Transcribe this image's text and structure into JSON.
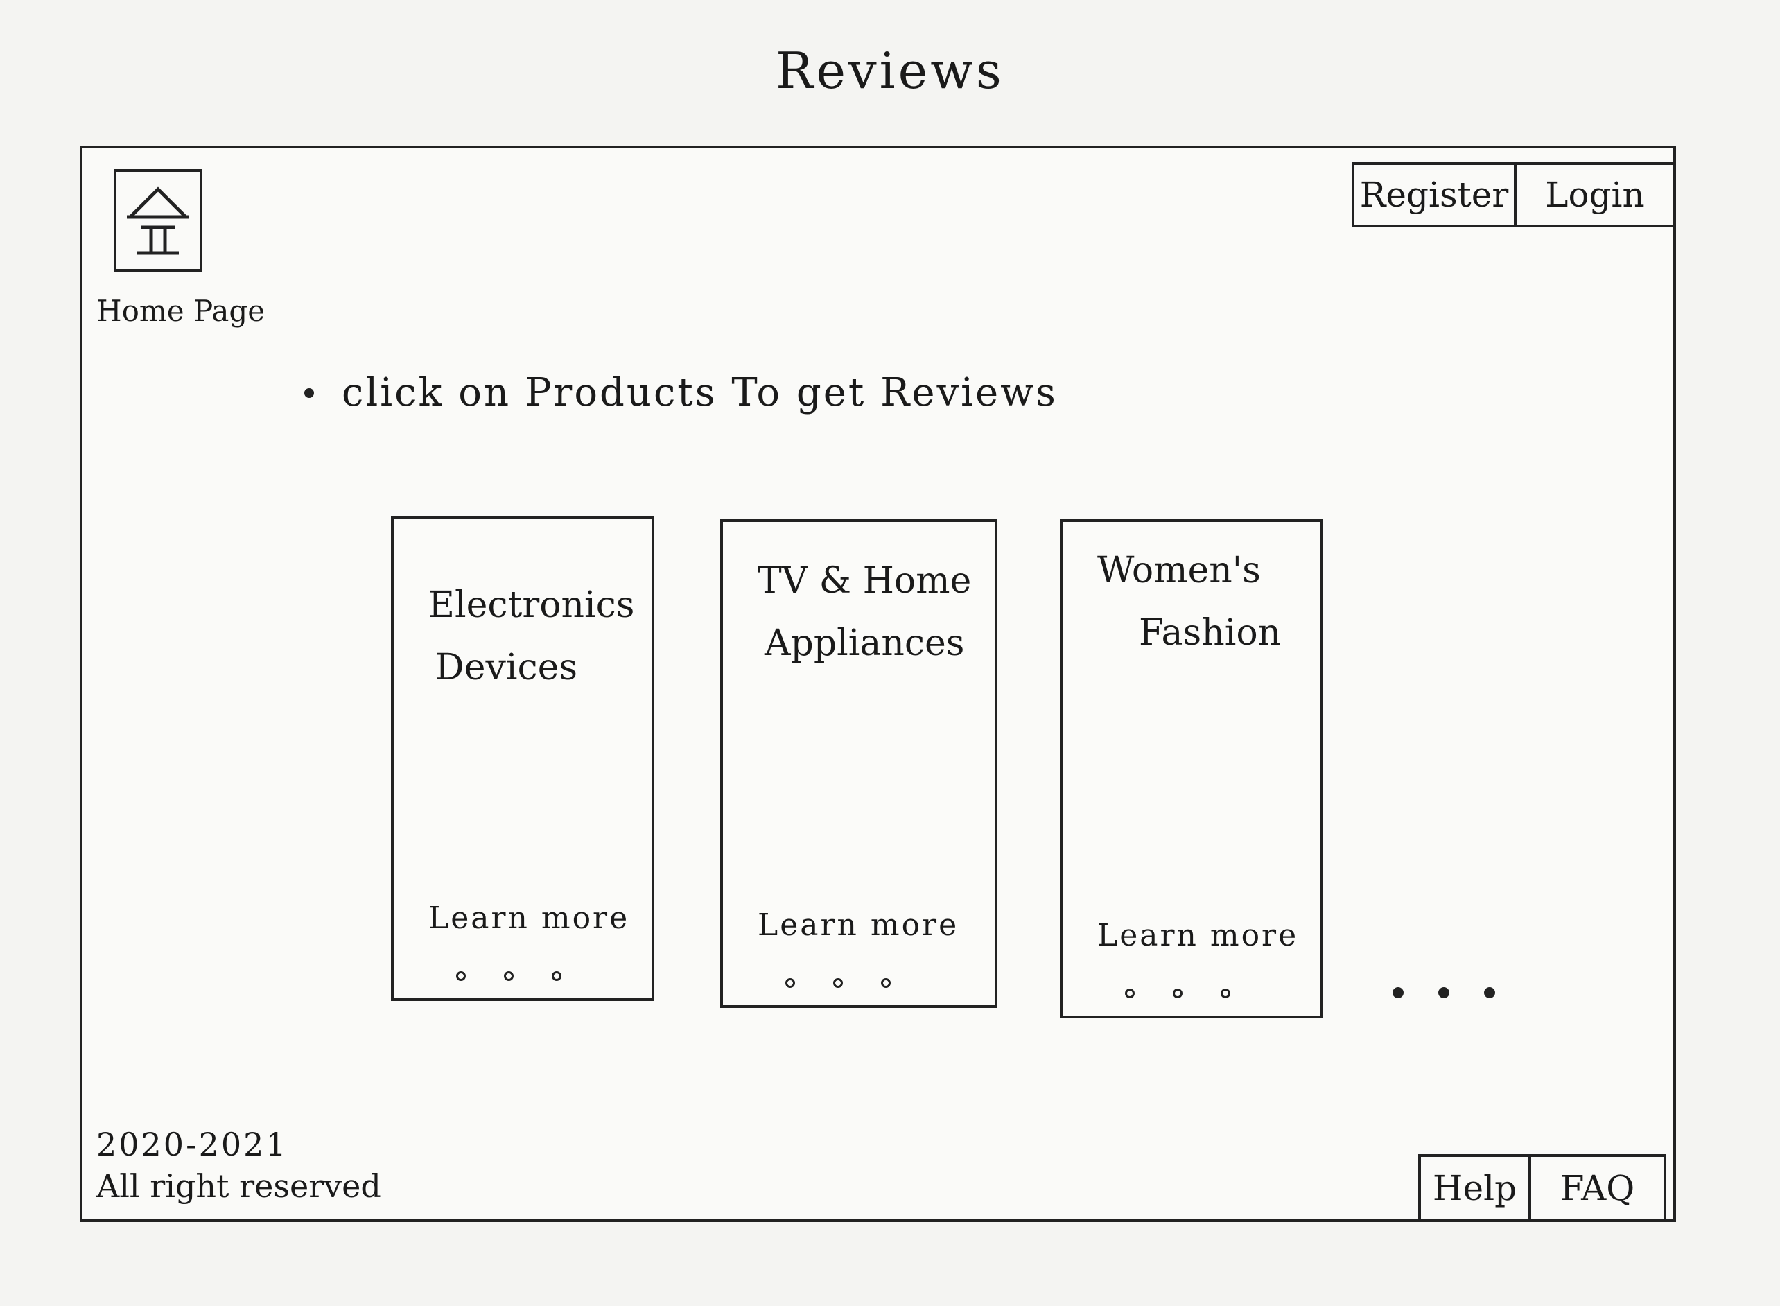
{
  "page": {
    "title": "Reviews"
  },
  "header": {
    "home_icon": "home-icon",
    "home_label": "Home Page",
    "register_label": "Register",
    "login_label": "Login"
  },
  "main": {
    "instruction": "click on Products To get Reviews",
    "cards": [
      {
        "title_line1": "Electronics",
        "title_line2": "Devices",
        "link_label": "Learn more"
      },
      {
        "title_line1": "TV & Home",
        "title_line2": "Appliances",
        "link_label": "Learn more"
      },
      {
        "title_line1": "Women's",
        "title_line2": "Fashion",
        "link_label": "Learn more"
      }
    ]
  },
  "footer": {
    "years": "2020-2021",
    "rights": "All right reserved",
    "help_label": "Help",
    "faq_label": "FAQ"
  }
}
